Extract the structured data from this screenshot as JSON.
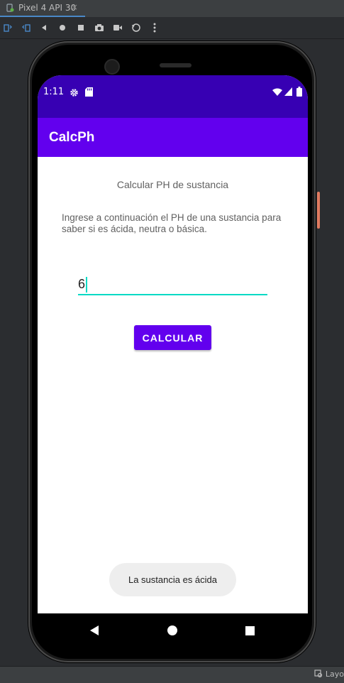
{
  "emulator": {
    "tab_label": "Pixel 4 API 30",
    "tab_close": "×",
    "toolbar_icons": [
      "rotate-left-icon",
      "rotate-right-icon",
      "back-icon",
      "home-icon",
      "overview-icon",
      "screenshot-icon",
      "record-icon",
      "restore-icon",
      "more-icon"
    ],
    "bottom_label": "Layo"
  },
  "status_bar": {
    "time": "1:11"
  },
  "app": {
    "title": "CalcPh",
    "heading": "Calcular PH de sustancia",
    "description": "Ingrese a continuación el PH de una sustancia para saber si es ácida, neutra o  básica.",
    "input_value": "6",
    "button_label": "CALCULAR",
    "toast": "La sustancia es ácida"
  },
  "colors": {
    "primary": "#6200ee",
    "primary_dark": "#3700b3",
    "accent": "#03dac5"
  }
}
